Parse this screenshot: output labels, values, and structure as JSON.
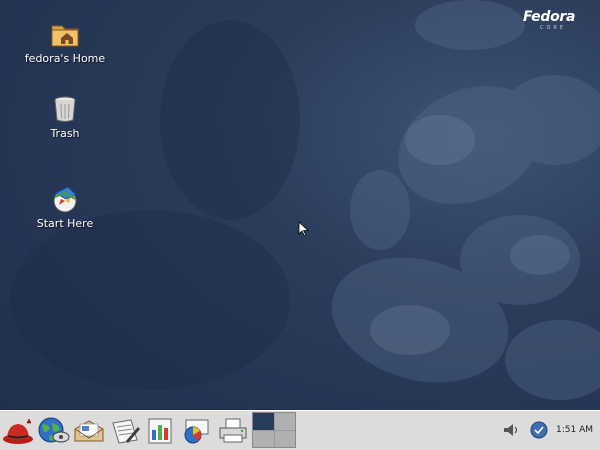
{
  "brand": {
    "name": "Fedora",
    "sub": "CORE"
  },
  "desktop_icons": [
    {
      "label": "fedora's Home",
      "icon": "home-folder-icon"
    },
    {
      "label": "Trash",
      "icon": "trash-icon"
    },
    {
      "label": "Start Here",
      "icon": "start-here-icon"
    }
  ],
  "panel": {
    "launchers": [
      {
        "icon": "redhat-menu-icon"
      },
      {
        "icon": "web-browser-icon"
      },
      {
        "icon": "email-icon"
      },
      {
        "icon": "word-processor-icon"
      },
      {
        "icon": "spreadsheet-icon"
      },
      {
        "icon": "presentation-icon"
      },
      {
        "icon": "print-manager-icon"
      }
    ],
    "workspaces": {
      "count": 4,
      "active": 1
    },
    "tray": [
      {
        "icon": "volume-icon"
      },
      {
        "icon": "update-notifier-icon"
      }
    ],
    "clock": "1:51 AM"
  },
  "colors": {
    "desktop_bg": "#243554",
    "panel_bg": "#dcdcdc"
  }
}
